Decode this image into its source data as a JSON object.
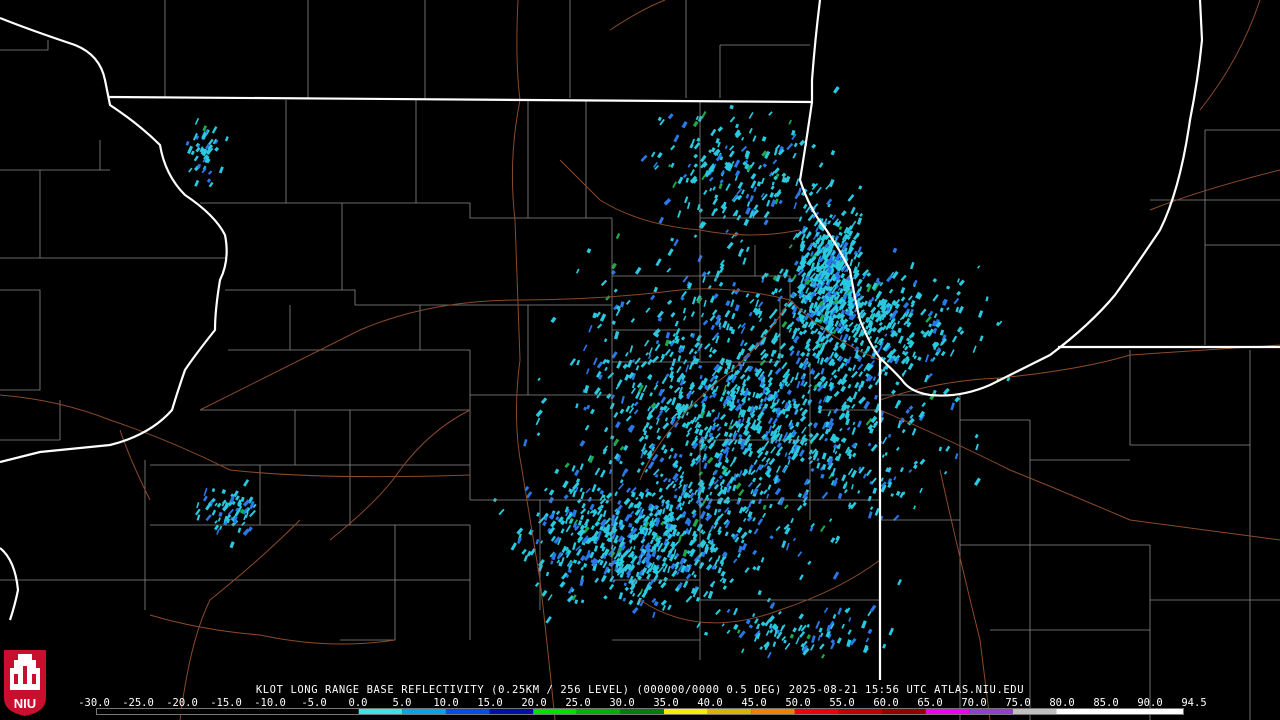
{
  "product_caption": "KLOT LONG RANGE BASE REFLECTIVITY (0.25KM / 256 LEVEL) (000000/0000 0.5 DEG) 2025-08-21 15:56 UTC  ATLAS.NIU.EDU",
  "logo_text": "NIU",
  "colors": {
    "background": "#000000",
    "state_borders": "#ffffff",
    "county_lines": "#8a8a8a",
    "roads": "#8b4a2a",
    "echo_light": "#29c9e0",
    "echo_medium": "#2a78e8",
    "echo_heavy": "#1ea84a",
    "logo_red": "#c8102e"
  },
  "legend": {
    "labels": [
      "-30.0",
      "-25.0",
      "-20.0",
      "-15.0",
      "-10.0",
      "-5.0",
      "0.0",
      "5.0",
      "10.0",
      "15.0",
      "20.0",
      "25.0",
      "30.0",
      "35.0",
      "40.0",
      "45.0",
      "50.0",
      "55.0",
      "60.0",
      "65.0",
      "70.0",
      "75.0",
      "80.0",
      "85.0",
      "90.0",
      "94.5"
    ],
    "range": [
      -30.0,
      94.5
    ],
    "colors": [
      {
        "from": -30,
        "to": 0,
        "color": "#000000"
      },
      {
        "from": 0,
        "to": 5,
        "color": "#40e0e8"
      },
      {
        "from": 5,
        "to": 10,
        "color": "#10a0e8"
      },
      {
        "from": 10,
        "to": 15,
        "color": "#0050e0"
      },
      {
        "from": 15,
        "to": 20,
        "color": "#0010a0"
      },
      {
        "from": 20,
        "to": 25,
        "color": "#00e000"
      },
      {
        "from": 25,
        "to": 30,
        "color": "#00b000"
      },
      {
        "from": 30,
        "to": 35,
        "color": "#008000"
      },
      {
        "from": 35,
        "to": 40,
        "color": "#f0f000"
      },
      {
        "from": 40,
        "to": 45,
        "color": "#e0b000"
      },
      {
        "from": 45,
        "to": 50,
        "color": "#f08000"
      },
      {
        "from": 50,
        "to": 55,
        "color": "#f00000"
      },
      {
        "from": 55,
        "to": 60,
        "color": "#c00000"
      },
      {
        "from": 60,
        "to": 65,
        "color": "#900000"
      },
      {
        "from": 65,
        "to": 70,
        "color": "#f000f0"
      },
      {
        "from": 70,
        "to": 75,
        "color": "#9040d0"
      },
      {
        "from": 75,
        "to": 80,
        "color": "#c0c0c0"
      },
      {
        "from": 80,
        "to": 94.5,
        "color": "#ffffff"
      }
    ]
  }
}
